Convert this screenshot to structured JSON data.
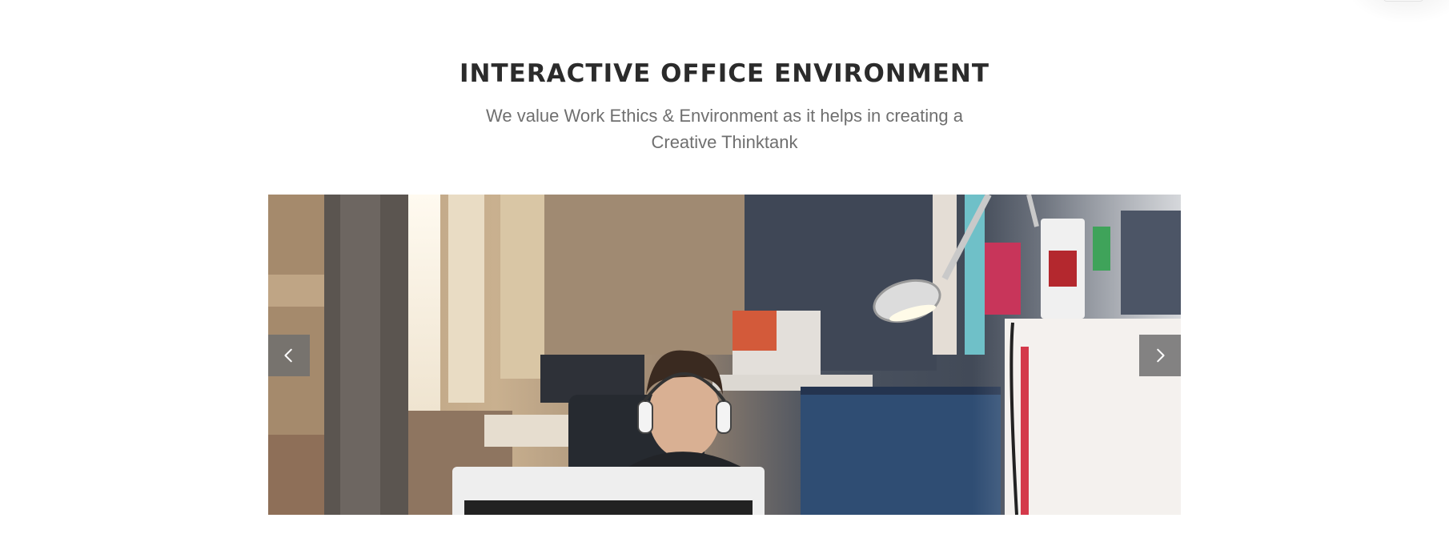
{
  "section": {
    "title": "INTERACTIVE OFFICE ENVIRONMENT",
    "subtitle": "We value Work Ethics & Environment as it helps in creating a Creative Thinktank"
  },
  "carousel": {
    "slide_description": "man-with-headphones-at-computer-in-office",
    "prev_icon": "chevron-left-icon",
    "next_icon": "chevron-right-icon"
  },
  "colors": {
    "title": "#2b2b2b",
    "subtitle": "#6f6f6f",
    "arrow_bg": "#6e6e6e"
  }
}
